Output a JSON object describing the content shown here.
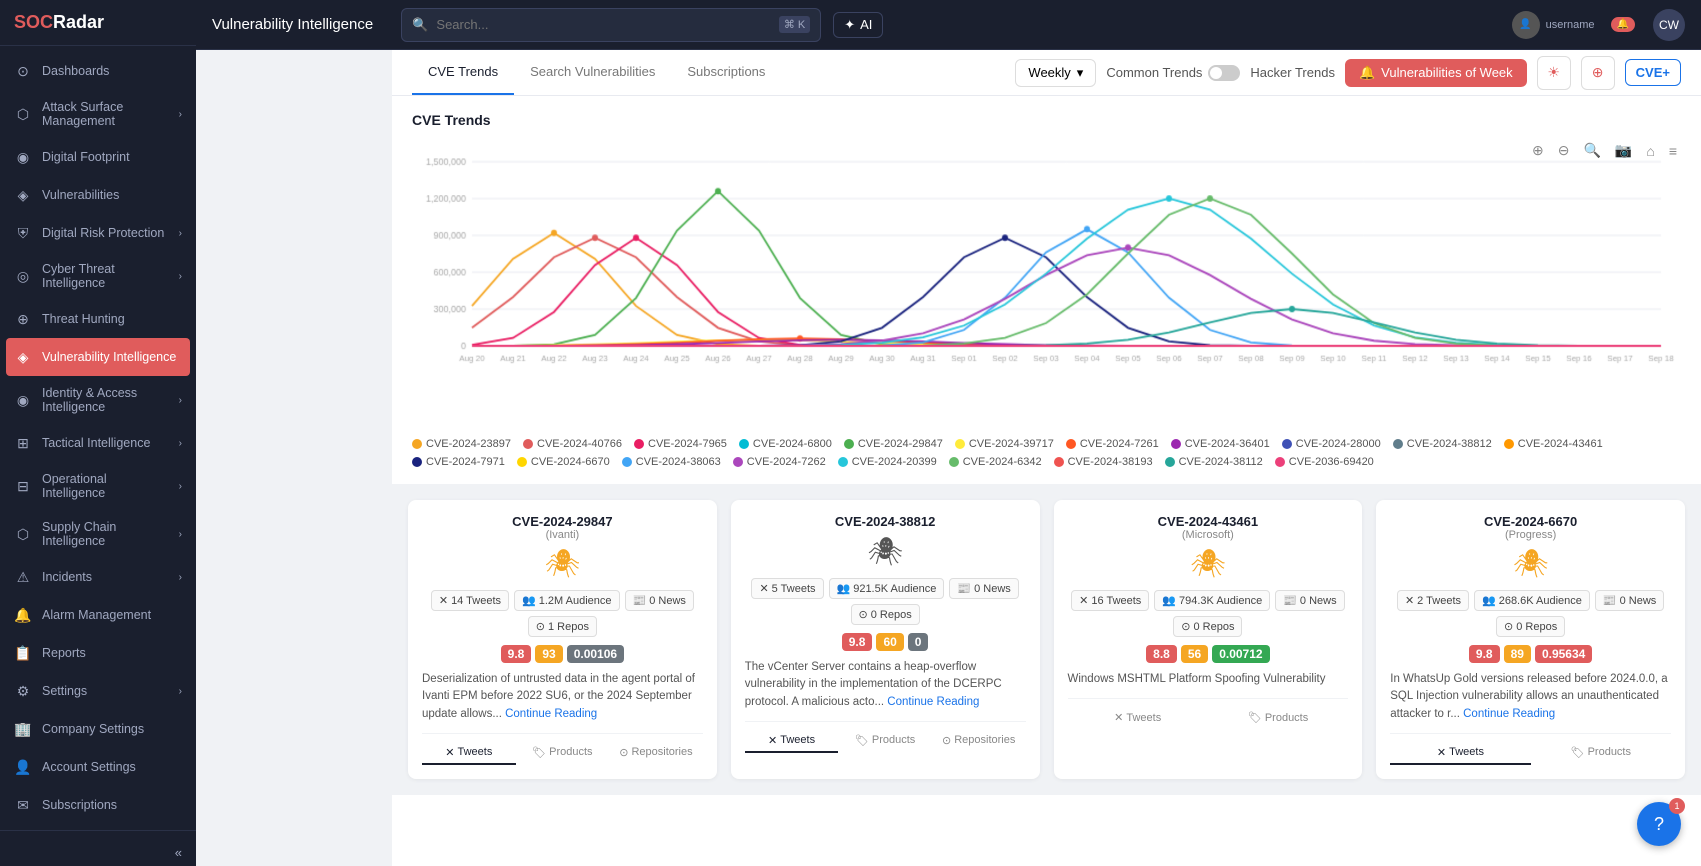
{
  "app": {
    "logo": "SOCRadar",
    "logo_highlight": "SOC"
  },
  "topbar": {
    "title": "Vulnerability Intelligence",
    "search_placeholder": "Search...",
    "search_shortcut": "⌘ K",
    "ai_label": "AI",
    "user_initials": "CW"
  },
  "sidebar": {
    "items": [
      {
        "id": "dashboards",
        "label": "Dashboards",
        "icon": "⊙",
        "has_arrow": false,
        "active": false
      },
      {
        "id": "attack-surface",
        "label": "Attack Surface Management",
        "icon": "⬡",
        "has_arrow": true,
        "active": false
      },
      {
        "id": "digital-footprint",
        "label": "Digital Footprint",
        "icon": "◉",
        "has_arrow": false,
        "active": false
      },
      {
        "id": "vulnerabilities",
        "label": "Vulnerabilities",
        "icon": "◈",
        "has_arrow": false,
        "active": false
      },
      {
        "id": "digital-risk",
        "label": "Digital Risk Protection",
        "icon": "⛨",
        "has_arrow": true,
        "active": false
      },
      {
        "id": "cyber-threat",
        "label": "Cyber Threat Intelligence",
        "icon": "◎",
        "has_arrow": true,
        "active": false
      },
      {
        "id": "threat-hunting",
        "label": "Threat Hunting",
        "icon": "⊕",
        "has_arrow": false,
        "active": false
      },
      {
        "id": "vuln-intel",
        "label": "Vulnerability Intelligence",
        "icon": "◈",
        "has_arrow": false,
        "active": true
      },
      {
        "id": "identity-access",
        "label": "Identity & Access Intelligence",
        "icon": "◉",
        "has_arrow": true,
        "active": false
      },
      {
        "id": "tactical-intel",
        "label": "Tactical Intelligence",
        "icon": "⊞",
        "has_arrow": true,
        "active": false
      },
      {
        "id": "operational-intel",
        "label": "Operational Intelligence",
        "icon": "⊟",
        "has_arrow": true,
        "active": false
      },
      {
        "id": "supply-chain",
        "label": "Supply Chain Intelligence",
        "icon": "⬡",
        "has_arrow": true,
        "active": false
      },
      {
        "id": "incidents",
        "label": "Incidents",
        "icon": "⚠",
        "has_arrow": true,
        "active": false
      },
      {
        "id": "alarm-mgmt",
        "label": "Alarm Management",
        "icon": "🔔",
        "has_arrow": false,
        "active": false
      },
      {
        "id": "reports",
        "label": "Reports",
        "icon": "📋",
        "has_arrow": false,
        "active": false
      },
      {
        "id": "settings",
        "label": "Settings",
        "icon": "⚙",
        "has_arrow": true,
        "active": false
      },
      {
        "id": "company-settings",
        "label": "Company Settings",
        "icon": "🏢",
        "has_arrow": false,
        "active": false
      },
      {
        "id": "account-settings",
        "label": "Account Settings",
        "icon": "👤",
        "has_arrow": false,
        "active": false
      },
      {
        "id": "subscriptions",
        "label": "Subscriptions",
        "icon": "✉",
        "has_arrow": false,
        "active": false
      }
    ]
  },
  "tabs": [
    {
      "id": "cve-trends",
      "label": "CVE Trends",
      "active": true
    },
    {
      "id": "search-vulns",
      "label": "Search Vulnerabilities",
      "active": false
    },
    {
      "id": "subscriptions",
      "label": "Subscriptions",
      "active": false
    }
  ],
  "controls": {
    "period": "Weekly",
    "common_trends_label": "Common Trends",
    "hacker_trends_label": "Hacker Trends",
    "toggle_on": false,
    "vuln_week_btn": "Vulnerabilities of Week",
    "cve_plus_btn": "CVE+"
  },
  "chart": {
    "title": "CVE Trends",
    "y_labels": [
      "1500000",
      "1200000",
      "900000",
      "600000",
      "300000",
      "0"
    ],
    "x_labels": [
      "Aug 20",
      "Aug 21",
      "Aug 22",
      "Aug 23",
      "Aug 24",
      "Aug 25",
      "Aug 26",
      "Aug 27",
      "Aug 28",
      "Aug 29",
      "Aug 30",
      "Aug 31",
      "Sep 01",
      "Sep 02",
      "Sep 03",
      "Sep 04",
      "Sep 05",
      "Sep 06",
      "Sep 07",
      "Sep 08",
      "Sep 09",
      "Sep 10",
      "Sep 11",
      "Sep 12",
      "Sep 13",
      "Sep 14",
      "Sep 15",
      "Sep 16",
      "Sep 17",
      "Sep 18"
    ]
  },
  "legend": [
    {
      "cve": "CVE-2024-23897",
      "color": "#f5a623"
    },
    {
      "cve": "CVE-2024-40766",
      "color": "#e05c5c"
    },
    {
      "cve": "CVE-2024-7965",
      "color": "#e91e63"
    },
    {
      "cve": "CVE-2024-6800",
      "color": "#00bcd4"
    },
    {
      "cve": "CVE-2024-29847",
      "color": "#4caf50"
    },
    {
      "cve": "CVE-2024-39717",
      "color": "#ffeb3b"
    },
    {
      "cve": "CVE-2024-7261",
      "color": "#ff5722"
    },
    {
      "cve": "CVE-2024-36401",
      "color": "#9c27b0"
    },
    {
      "cve": "CVE-2024-28000",
      "color": "#3f51b5"
    },
    {
      "cve": "CVE-2024-38812",
      "color": "#607d8b"
    },
    {
      "cve": "CVE-2024-43461",
      "color": "#ff9800"
    },
    {
      "cve": "CVE-2024-7971",
      "color": "#1a237e"
    },
    {
      "cve": "CVE-2024-6670",
      "color": "#ffd600"
    },
    {
      "cve": "CVE-2024-38063",
      "color": "#42a5f5"
    },
    {
      "cve": "CVE-2024-7262",
      "color": "#ab47bc"
    },
    {
      "cve": "CVE-2024-20399",
      "color": "#26c6da"
    },
    {
      "cve": "CVE-2024-6342",
      "color": "#66bb6a"
    },
    {
      "cve": "CVE-2024-38193",
      "color": "#ef5350"
    },
    {
      "cve": "CVE-2024-38112",
      "color": "#26a69a"
    },
    {
      "cve": "CVE-2036-69420",
      "color": "#ec407a"
    }
  ],
  "cve_cards": [
    {
      "id": "CVE-2024-29847",
      "vendor": "Ivanti",
      "icon": "🕷",
      "icon_color": "#f5a623",
      "tweets": "14 Tweets",
      "audience": "1.2M Audience",
      "news": "0 News",
      "repos": "1 Repos",
      "score1": "9.8",
      "score2": "93",
      "score3": "0.00106",
      "score1_class": "score-red",
      "score2_class": "score-orange",
      "score3_class": "score-gray",
      "desc": "Deserialization of untrusted data in the agent portal of Ivanti EPM before 2022 SU6, or the 2024 September update allows...",
      "read_more": "Continue Reading",
      "footer_tabs": [
        "Tweets",
        "Products",
        "Repositories"
      ],
      "active_footer": "Tweets"
    },
    {
      "id": "CVE-2024-38812",
      "vendor": "",
      "icon": "🕷",
      "icon_color": "#555",
      "tweets": "5 Tweets",
      "audience": "921.5K Audience",
      "news": "0 News",
      "repos": "0 Repos",
      "score1": "9.8",
      "score2": "60",
      "score3": "0",
      "score1_class": "score-red",
      "score2_class": "score-orange",
      "score3_class": "score-gray",
      "desc": "The vCenter Server contains a heap-overflow vulnerability in the implementation of the DCERPC protocol. A malicious acto...",
      "read_more": "Continue Reading",
      "footer_tabs": [
        "Tweets",
        "Products",
        "Repositories"
      ],
      "active_footer": "Tweets"
    },
    {
      "id": "CVE-2024-43461",
      "vendor": "Microsoft",
      "icon": "🕷",
      "icon_color": "#f5a623",
      "tweets": "16 Tweets",
      "audience": "794.3K Audience",
      "news": "0 News",
      "repos": "0 Repos",
      "score1": "8.8",
      "score2": "56",
      "score3": "0.00712",
      "score1_class": "score-red",
      "score2_class": "score-orange",
      "score3_class": "score-green",
      "desc": "Windows MSHTML Platform Spoofing Vulnerability",
      "read_more": "",
      "footer_tabs": [
        "Tweets",
        "Products"
      ],
      "active_footer": ""
    },
    {
      "id": "CVE-2024-6670",
      "vendor": "Progress",
      "icon": "🕷",
      "icon_color": "#f5a623",
      "tweets": "2 Tweets",
      "audience": "268.6K Audience",
      "news": "0 News",
      "repos": "0 Repos",
      "score1": "9.8",
      "score2": "89",
      "score3": "0.95634",
      "score1_class": "score-red",
      "score2_class": "score-orange",
      "score3_class": "score-red",
      "desc": "In WhatsUp Gold versions released before 2024.0.0, a SQL Injection vulnerability allows an unauthenticated attacker to r...",
      "read_more": "Continue Reading",
      "footer_tabs": [
        "Tweets",
        "Products"
      ],
      "active_footer": "Tweets"
    }
  ],
  "chat_badge": "1"
}
